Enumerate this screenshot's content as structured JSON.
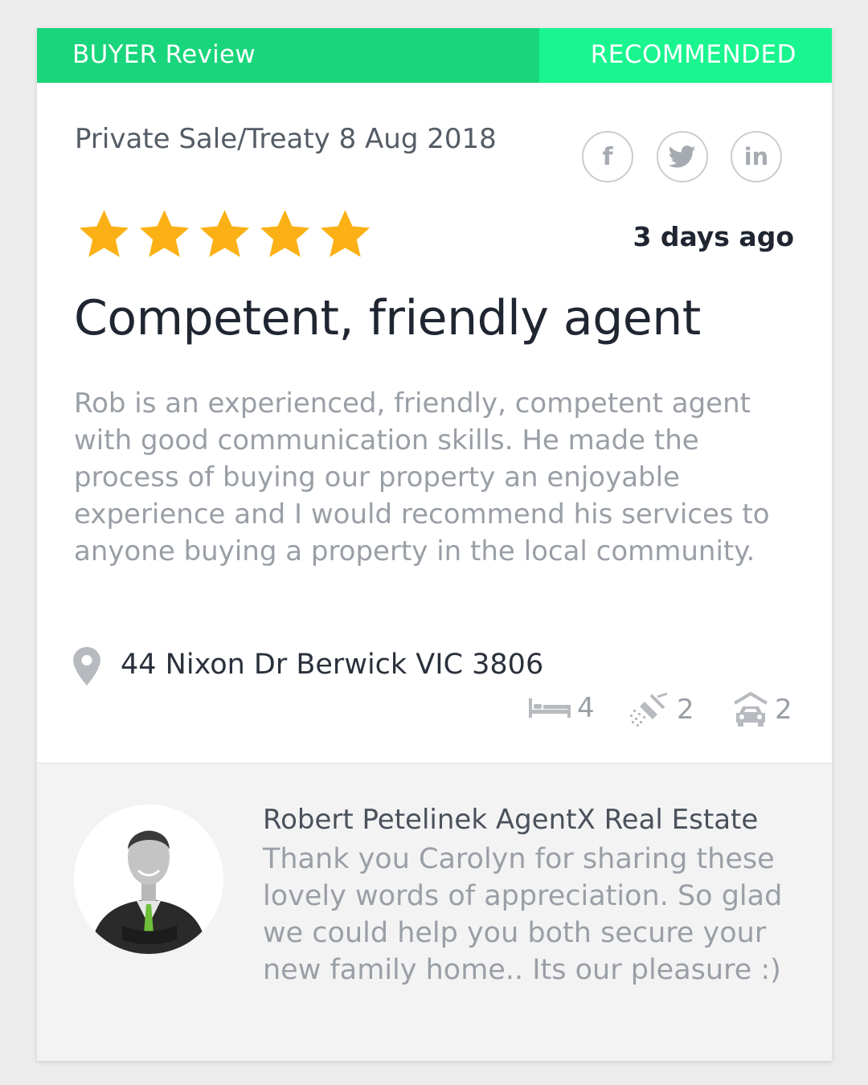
{
  "banner": {
    "type_label": "BUYER Review",
    "status_label": "RECOMMENDED",
    "colors": {
      "left": "#19d57b",
      "right": "#19f58f"
    }
  },
  "review": {
    "sale_info": "Private Sale/Treaty 8 Aug 2018",
    "rating": 5,
    "rating_max": 5,
    "star_color": "#fbb116",
    "time_ago": "3 days ago",
    "title": "Competent, friendly agent",
    "body": "Rob is an experienced, friendly, competent agent with good communication skills. He made the process of buying our property an enjoyable experience and I would recommend his services to anyone buying a property in the local community."
  },
  "share": {
    "icons": [
      "facebook-icon",
      "twitter-icon",
      "linkedin-icon"
    ]
  },
  "property": {
    "address": "44 Nixon Dr Berwick VIC 3806",
    "bedrooms": "4",
    "bathrooms": "2",
    "car_spaces": "2",
    "icons": [
      "location-pin-icon",
      "bed-icon",
      "shower-icon",
      "car-icon"
    ]
  },
  "agent_reply": {
    "agent_name": "Robert Petelinek AgentX Real Estate",
    "message": "Thank you Carolyn for sharing these lovely words of appreciation. So glad we could help you both secure your new family home.. Its our pleasure :)"
  }
}
